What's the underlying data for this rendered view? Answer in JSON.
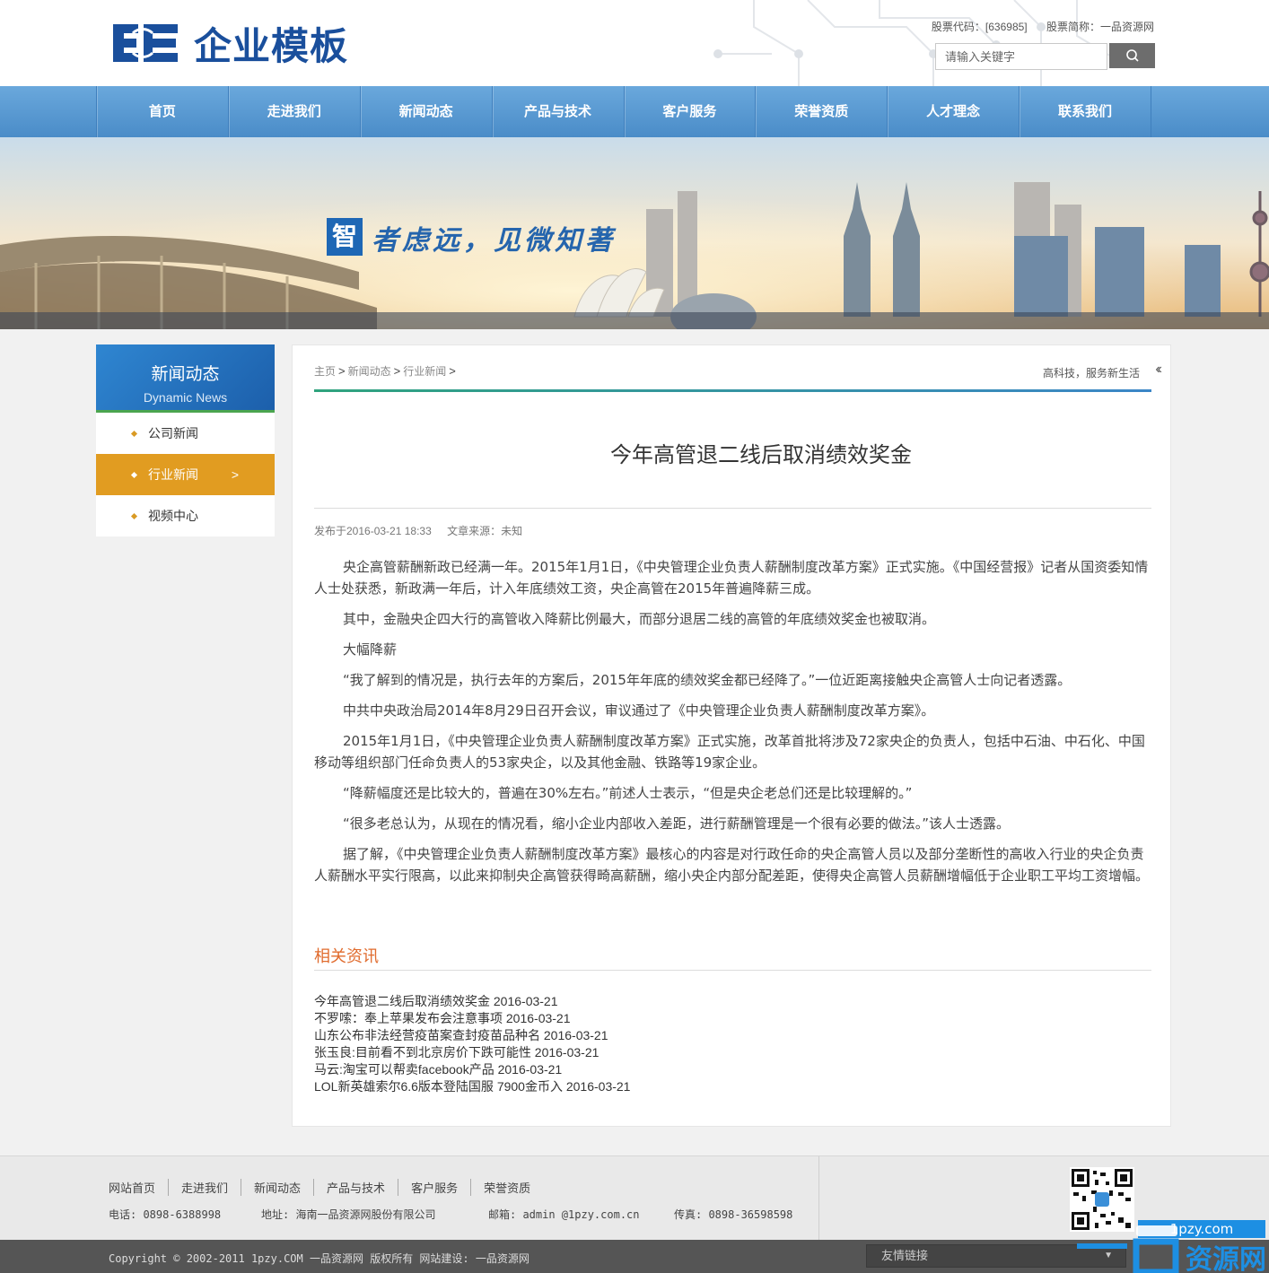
{
  "header": {
    "logo_text": "企业模板",
    "stock_code": "股票代码：[636985]",
    "stock_name": "股票简称：一品资源网",
    "search_placeholder": "请输入关键字"
  },
  "nav": {
    "items": [
      "首页",
      "走进我们",
      "新闻动态",
      "产品与技术",
      "客户服务",
      "荣誉资质",
      "人才理念",
      "联系我们"
    ]
  },
  "banner": {
    "slogan_first": "智",
    "slogan_rest": "者虑远，见微知著"
  },
  "sidebar": {
    "title": "新闻动态",
    "subtitle": "Dynamic News",
    "items": [
      {
        "label": "公司新闻"
      },
      {
        "label": "行业新闻",
        "arrow": ">"
      },
      {
        "label": "视频中心"
      }
    ]
  },
  "breadcrumb": {
    "items": [
      "主页",
      "新闻动态",
      "行业新闻"
    ],
    "sep": ">",
    "tagline": "高科技，服务新生活",
    "chevrons": "‹‹"
  },
  "article": {
    "title": "今年高管退二线后取消绩效奖金",
    "published": "发布于2016-03-21 18:33",
    "source": "文章来源：未知",
    "paragraphs": [
      "央企高管薪酬新政已经满一年。2015年1月1日，《中央管理企业负责人薪酬制度改革方案》正式实施。《中国经营报》记者从国资委知情人士处获悉，新政满一年后，计入年底绩效工资，央企高管在2015年普遍降薪三成。",
      "其中，金融央企四大行的高管收入降薪比例最大，而部分退居二线的高管的年底绩效奖金也被取消。",
      "大幅降薪",
      "“我了解到的情况是，执行去年的方案后，2015年年底的绩效奖金都已经降了。”一位近距离接触央企高管人士向记者透露。",
      "中共中央政治局2014年8月29日召开会议，审议通过了《中央管理企业负责人薪酬制度改革方案》。",
      "2015年1月1日，《中央管理企业负责人薪酬制度改革方案》正式实施，改革首批将涉及72家央企的负责人，包括中石油、中石化、中国移动等组织部门任命负责人的53家央企，以及其他金融、铁路等19家企业。",
      "“降薪幅度还是比较大的，普遍在30%左右。”前述人士表示，“但是央企老总们还是比较理解的。”",
      "“很多老总认为，从现在的情况看，缩小企业内部收入差距，进行薪酬管理是一个很有必要的做法。”该人士透露。",
      "据了解，《中央管理企业负责人薪酬制度改革方案》最核心的内容是对行政任命的央企高管人员以及部分垄断性的高收入行业的央企负责人薪酬水平实行限高，以此来抑制央企高管获得畸高薪酬，缩小央企内部分配差距，使得央企高管人员薪酬增幅低于企业职工平均工资增幅。"
    ]
  },
  "related": {
    "title": "相关资讯",
    "items": [
      "今年高管退二线后取消绩效奖金 2016-03-21",
      "不罗嗦：奉上苹果发布会注意事项 2016-03-21",
      "山东公布非法经营疫苗案查封疫苗品种名 2016-03-21",
      "张玉良:目前看不到北京房价下跌可能性 2016-03-21",
      "马云:淘宝可以帮卖facebook产品 2016-03-21",
      "LOL新英雄索尔6.6版本登陆国服 7900金币入 2016-03-21"
    ]
  },
  "footer": {
    "links": [
      "网站首页",
      "走进我们",
      "新闻动态",
      "产品与技术",
      "客户服务",
      "荣誉资质"
    ],
    "phone": "电话: 0898-6388998",
    "address": "地址: 海南一品资源网股份有限公司",
    "email": "邮箱: admin @1pzy.com.cn",
    "fax": "传真: 0898-36598598",
    "copyright": "Copyright © 2002-2011 1pzy.COM 一品资源网 版权所有  网站建设: 一品资源网",
    "friend_links": "友情链接",
    "friend_caret": "▼"
  },
  "watermark": {
    "domain": "1pzy.com",
    "text": "资源网"
  },
  "colors": {
    "nav_blue": "#4a8cc8",
    "active_orange": "#e19c21",
    "related_orange": "#e06b2d",
    "logo_blue": "#1a4f9c"
  },
  "icons": [
    "search-icon",
    "diamond-bullet-icon",
    "chevron-right-icon",
    "double-chevron-left-icon",
    "qr-code-icon",
    "caret-down-icon"
  ]
}
